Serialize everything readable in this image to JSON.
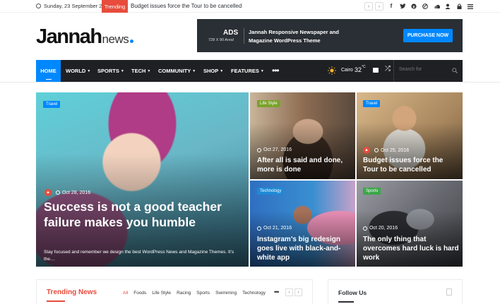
{
  "topbar": {
    "date": "Sunday, 23 September 2018",
    "trending_label": "Trending",
    "headline": "Budget issues force the Tour to be cancelled",
    "prev_icon": "chevron-left-icon",
    "next_icon": "chevron-right-icon",
    "social": [
      "facebook-icon",
      "twitter-icon",
      "pinterest-icon",
      "dribbble-icon",
      "soundcloud-icon",
      "user-icon",
      "lock-icon",
      "menu-icon"
    ]
  },
  "logo": {
    "main": "Jannah",
    "sub": "news"
  },
  "ad": {
    "title": "ADS",
    "size": "728 X 90 Area!",
    "line1": "Jannah Responsive Newspaper and",
    "line2": "Magazine WordPress Theme",
    "button": "PURCHASE NOW"
  },
  "nav": {
    "items": [
      {
        "label": "HOME",
        "caret": ""
      },
      {
        "label": "WORLD",
        "caret": "▼"
      },
      {
        "label": "SPORTS",
        "caret": "▼"
      },
      {
        "label": "TECH",
        "caret": "▼"
      },
      {
        "label": "COMMUNITY",
        "caret": "▼"
      },
      {
        "label": "SHOP",
        "caret": "▼"
      },
      {
        "label": "FEATURES",
        "caret": "▼"
      }
    ],
    "more": "•••",
    "weather_city": "Cairo",
    "weather_temp": "32",
    "weather_unit": "°C",
    "search_placeholder": "Search for"
  },
  "featured": [
    {
      "category": "Travel",
      "category_color": "#0088ff",
      "date": "Oct 28, 2016",
      "title": "Success is not a good teacher failure makes you humble",
      "excerpt": "Stay focused and remember we design the best WordPress News and Magazine Themes. It’s the…",
      "bg": "#6fb8cc"
    },
    {
      "category": "Life Style",
      "category_color": "#7aa22a",
      "date": "Oct 27, 2016",
      "title": "After all is said and done, more is done",
      "bg": "#8a7058"
    },
    {
      "category": "Travel",
      "category_color": "#0088ff",
      "date": "Oct 25, 2016",
      "title": "Budget issues force the Tour to be cancelled",
      "bg": "#b69a70"
    },
    {
      "category": "Technology",
      "category_color": "#1e8ad6",
      "date": "Oct 21, 2016",
      "title": "Instagram’s big redesign goes live with black-and-white app",
      "bg": "#3a8fd1"
    },
    {
      "category": "Sports",
      "category_color": "#3ca64a",
      "date": "Oct 20, 2016",
      "title": "The only thing that overcomes hard luck is hard work",
      "bg": "#5d6066"
    }
  ],
  "trending": {
    "title": "Trending News",
    "filters": [
      "All",
      "Foods",
      "Life Style",
      "Racing",
      "Sports",
      "Swimming",
      "Technology"
    ],
    "more": "•••"
  },
  "follow": {
    "title": "Follow Us"
  },
  "colors": {
    "accent": "#0088ff",
    "trending_red": "#e74c3c",
    "nav_bg": "#1f2024"
  }
}
